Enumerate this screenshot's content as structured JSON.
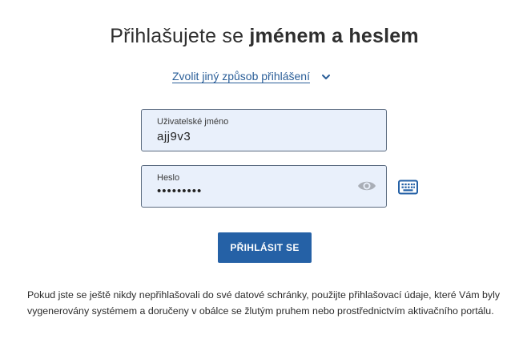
{
  "header": {
    "title_regular": "Přihlašujete se ",
    "title_bold": "jménem a heslem"
  },
  "alt_login": {
    "label": "Zvolit jiný způsob přihlášení",
    "icon": "chevron-down-icon"
  },
  "username_field": {
    "label": "Uživatelské jméno",
    "value": "ajj9v3"
  },
  "password_field": {
    "label": "Heslo",
    "value": "•••••••••",
    "toggle_icon": "eye-icon"
  },
  "keyboard": {
    "icon": "keyboard-icon"
  },
  "submit": {
    "label": "PŘIHLÁSIT SE"
  },
  "info_text": "Pokud jste se ještě nikdy nepřihlašovali do své datové schránky, použijte přihlašovací údaje, které Vám byly vygenerovány systémem a doručeny v obálce se žlutým pruhem nebo prostřednictvím aktivačního portálu.",
  "colors": {
    "accent": "#2561a6",
    "link": "#2a5e98",
    "field_bg": "#e9f0fb",
    "field_border": "#5b6b80"
  }
}
